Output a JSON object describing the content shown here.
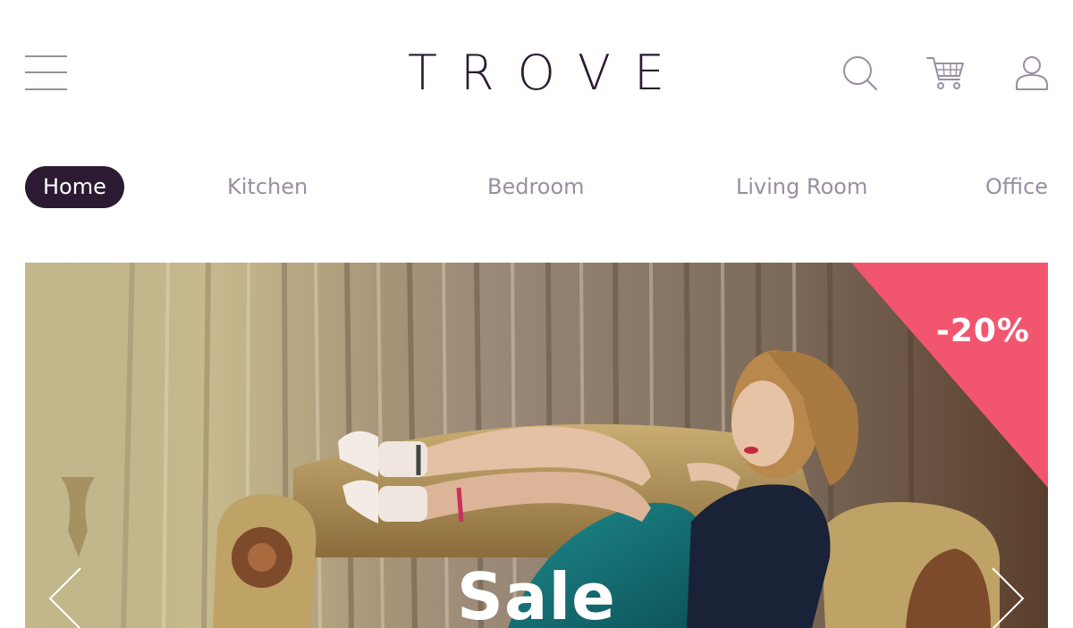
{
  "header": {
    "logo": "TROVE",
    "icons": [
      "menu-icon",
      "search-icon",
      "cart-icon",
      "user-icon"
    ]
  },
  "nav": {
    "items": [
      {
        "label": "Home",
        "active": true
      },
      {
        "label": "Kitchen",
        "active": false
      },
      {
        "label": "Bedroom",
        "active": false
      },
      {
        "label": "Living Room",
        "active": false
      },
      {
        "label": "Office",
        "active": false
      }
    ]
  },
  "hero": {
    "title": "Sale",
    "badge": "-20%",
    "badge_color": "#f2566f",
    "image_subject": "woman reclining on an ornate gold armchair in front of silk curtains",
    "arrows": [
      "chevron-left-icon",
      "chevron-right-icon"
    ]
  },
  "colors": {
    "brand": "#2c1a32",
    "muted": "#9a8ea2",
    "accent": "#f2566f"
  }
}
